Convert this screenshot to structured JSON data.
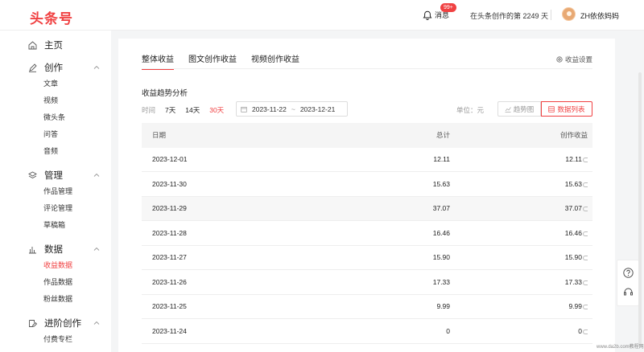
{
  "header": {
    "logo": "头条号",
    "messages_label": "消息",
    "messages_badge": "99+",
    "days_text": "在头条创作的第 2249 天",
    "username": "ZH依依妈妈"
  },
  "sidebar": {
    "home": "主页",
    "create": {
      "title": "创作",
      "items": [
        "文章",
        "视频",
        "微头条",
        "问答",
        "音频"
      ]
    },
    "manage": {
      "title": "管理",
      "items": [
        "作品管理",
        "评论管理",
        "草稿箱"
      ]
    },
    "data": {
      "title": "数据",
      "items": [
        "收益数据",
        "作品数据",
        "粉丝数据"
      ],
      "active_index": 0
    },
    "advanced": {
      "title": "进阶创作",
      "items": [
        "付费专栏"
      ]
    }
  },
  "main": {
    "tabs": [
      "整体收益",
      "图文创作收益",
      "视频创作收益"
    ],
    "active_tab": 0,
    "settings_label": "收益设置",
    "trend_title": "收益趋势分析",
    "filter": {
      "label": "时间",
      "options": [
        "7天",
        "14天",
        "30天"
      ],
      "selected": 2,
      "start_date": "2023-11-22",
      "range_sep": "~",
      "end_date": "2023-12-21"
    },
    "unit_label": "单位：元",
    "view_chart_label": "趋势图",
    "view_list_label": "数据列表",
    "table": {
      "headers": [
        "日期",
        "总计",
        "创作收益"
      ],
      "rows": [
        [
          "2023-12-01",
          "12.11",
          "12.11"
        ],
        [
          "2023-11-30",
          "15.63",
          "15.63"
        ],
        [
          "2023-11-29",
          "37.07",
          "37.07"
        ],
        [
          "2023-11-28",
          "16.46",
          "16.46"
        ],
        [
          "2023-11-27",
          "15.90",
          "15.90"
        ],
        [
          "2023-11-26",
          "17.33",
          "17.33"
        ],
        [
          "2023-11-25",
          "9.99",
          "9.99"
        ],
        [
          "2023-11-24",
          "0",
          "0"
        ]
      ]
    }
  },
  "watermark": "www.da2b.com教程网",
  "colors": {
    "accent": "#f04142",
    "icons": [
      "bell-icon",
      "home-icon",
      "pen-icon",
      "layers-icon",
      "bar-chart-icon",
      "edit-icon",
      "chevron-up-icon",
      "gear-icon",
      "calendar-icon",
      "help-icon",
      "headset-icon"
    ]
  }
}
